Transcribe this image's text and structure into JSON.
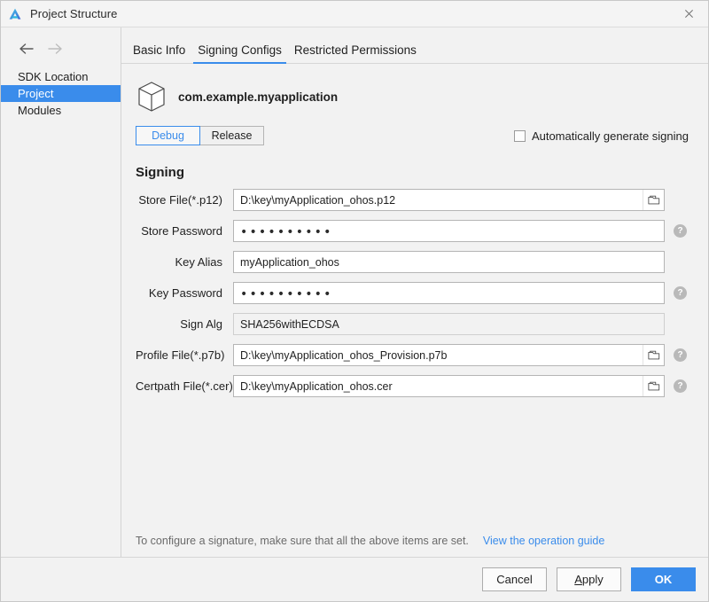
{
  "window": {
    "title": "Project Structure",
    "logo_icon": "deveco-logo-icon",
    "close_icon": "close-icon"
  },
  "sidebar": {
    "back_icon": "arrow-left-icon",
    "forward_icon": "arrow-right-icon",
    "items": [
      {
        "label": "SDK Location",
        "selected": false
      },
      {
        "label": "Project",
        "selected": true
      },
      {
        "label": "Modules",
        "selected": false
      }
    ]
  },
  "tabs": [
    {
      "label": "Basic Info",
      "active": false
    },
    {
      "label": "Signing Configs",
      "active": true
    },
    {
      "label": "Restricted Permissions",
      "active": false
    }
  ],
  "package": {
    "icon": "package-cube-icon",
    "name": "com.example.myapplication"
  },
  "build_variants": {
    "options": [
      {
        "label": "Debug",
        "active": true
      },
      {
        "label": "Release",
        "active": false
      }
    ]
  },
  "auto_generate": {
    "label": "Automatically generate signing",
    "checked": false
  },
  "signing": {
    "section_title": "Signing",
    "fields": [
      {
        "label": "Store File(*.p12)",
        "value": "D:\\key\\myApplication_ohos.p12",
        "type": "text",
        "browse": true,
        "help": false,
        "readonly": false,
        "name": "store-file"
      },
      {
        "label": "Store Password",
        "value": "••••••••••",
        "type": "password",
        "browse": false,
        "help": true,
        "readonly": false,
        "name": "store-password"
      },
      {
        "label": "Key Alias",
        "value": "myApplication_ohos",
        "type": "text",
        "browse": false,
        "help": false,
        "readonly": false,
        "name": "key-alias"
      },
      {
        "label": "Key Password",
        "value": "••••••••••",
        "type": "password",
        "browse": false,
        "help": true,
        "readonly": false,
        "name": "key-password"
      },
      {
        "label": "Sign Alg",
        "value": "SHA256withECDSA",
        "type": "text",
        "browse": false,
        "help": false,
        "readonly": true,
        "name": "sign-alg"
      },
      {
        "label": "Profile File(*.p7b)",
        "value": "D:\\key\\myApplication_ohos_Provision.p7b",
        "type": "text",
        "browse": true,
        "help": true,
        "readonly": false,
        "name": "profile-file"
      },
      {
        "label": "Certpath File(*.cer)",
        "value": "D:\\key\\myApplication_ohos.cer",
        "type": "text",
        "browse": true,
        "help": true,
        "readonly": false,
        "name": "certpath-file"
      }
    ]
  },
  "note": {
    "text": "To configure a signature, make sure that all the above items are set.",
    "link": "View the operation guide"
  },
  "buttons": {
    "cancel": "Cancel",
    "apply_prefix": "A",
    "apply_rest": "pply",
    "ok": "OK"
  },
  "colors": {
    "accent": "#3a8ceb",
    "selected_row": "#3a8ceb",
    "link": "#3a8ceb",
    "window_bg": "#f2f2f2",
    "field_bg": "#ffffff"
  }
}
